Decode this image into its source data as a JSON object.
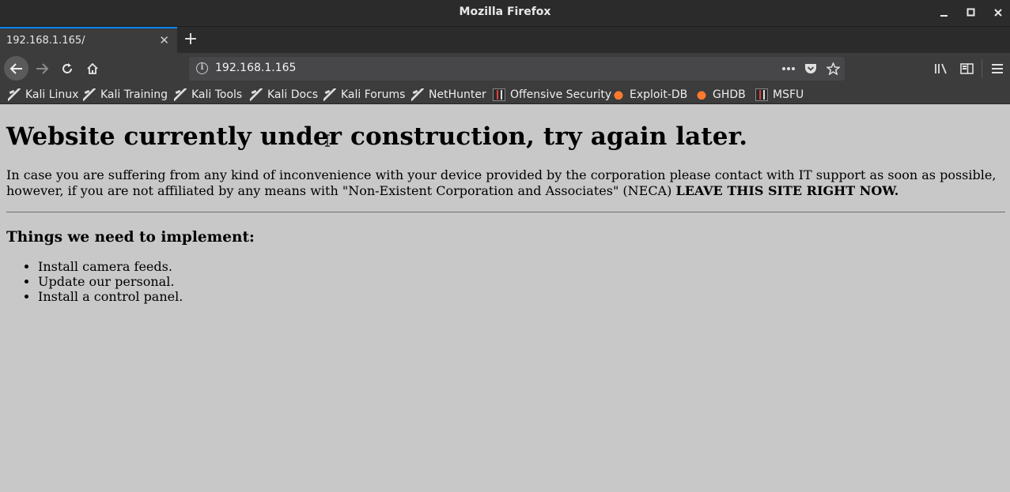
{
  "window": {
    "title": "Mozilla Firefox"
  },
  "tab": {
    "label": "192.168.1.165/"
  },
  "navbar": {
    "url": "192.168.1.165"
  },
  "bookmarks": [
    {
      "label": "Kali Linux",
      "icon": "kali-dragon-icon"
    },
    {
      "label": "Kali Training",
      "icon": "kali-dragon-icon"
    },
    {
      "label": "Kali Tools",
      "icon": "kali-dragon-icon"
    },
    {
      "label": "Kali Docs",
      "icon": "kali-dragon-icon"
    },
    {
      "label": "Kali Forums",
      "icon": "kali-dragon-icon"
    },
    {
      "label": "NetHunter",
      "icon": "kali-dragon-icon"
    },
    {
      "label": "Offensive Security",
      "icon": "offsec-icon"
    },
    {
      "label": "Exploit-DB",
      "icon": "exploit-db-icon"
    },
    {
      "label": "GHDB",
      "icon": "exploit-db-icon"
    },
    {
      "label": "MSFU",
      "icon": "offsec-icon"
    }
  ],
  "content": {
    "heading": "Website currently under construction, try again later.",
    "paragraph_text": "In case you are suffering from any kind of inconvenience with your device provided by the corporation please contact with IT support as soon as possible, however, if you are not affiliated by any means with \"Non-Existent Corporation and Associates\" (NECA) ",
    "paragraph_bold": "LEAVE THIS SITE RIGHT NOW.",
    "subheading": "Things we need to implement:",
    "items": [
      "Install camera feeds.",
      "Update our personal.",
      "Install a control panel."
    ]
  },
  "colors": {
    "chrome_dark": "#2b2b2b",
    "toolbar": "#3c3c3c",
    "urlbar": "#474749",
    "page_bg": "#c8c8c8",
    "tab_accent": "#0a84ff"
  }
}
